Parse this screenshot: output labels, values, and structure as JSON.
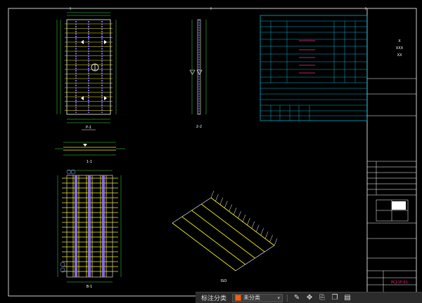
{
  "drawing": {
    "plan_title": "P-1",
    "side_title": "1-1",
    "side_title2": "2-2",
    "bottom_plan_title": "B-1",
    "iso_title": "ISO",
    "title_block": {
      "project_lines": [
        "X",
        "XXX",
        "XX"
      ],
      "drawing_name": "PCJ-1F-01"
    }
  },
  "toolbar": {
    "label": "标注分类",
    "dropdown_value": "未分类",
    "swatch_color": "#e8641b",
    "icons": [
      "edit-icon",
      "move-icon",
      "share-icon",
      "copy-icon",
      "paste-icon"
    ]
  },
  "colors": {
    "frame": "#ffffff",
    "table": "#00c8e6",
    "rebar": "#f5f500",
    "dim": "#4be04b",
    "strand": "#9a7cff",
    "highlight": "#ff2a8a"
  }
}
